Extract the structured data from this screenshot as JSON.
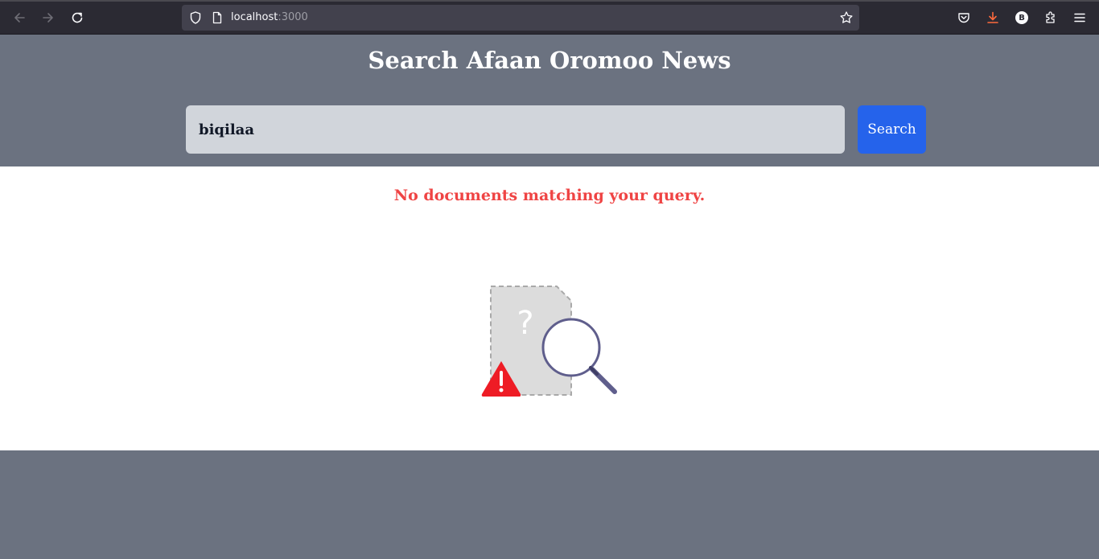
{
  "browser": {
    "url_host": "localhost",
    "url_port": ":3000",
    "profile_initial": "B"
  },
  "header": {
    "title": "Search Afaan Oromoo News"
  },
  "search": {
    "query": "biqilaa",
    "button_label": "Search"
  },
  "results": {
    "message": "No documents matching your query.",
    "illustration_glyph": "?"
  },
  "colors": {
    "header_bg": "#6b7280",
    "button_bg": "#2563eb",
    "error_text": "#ef4444",
    "input_bg": "#d1d5db"
  }
}
